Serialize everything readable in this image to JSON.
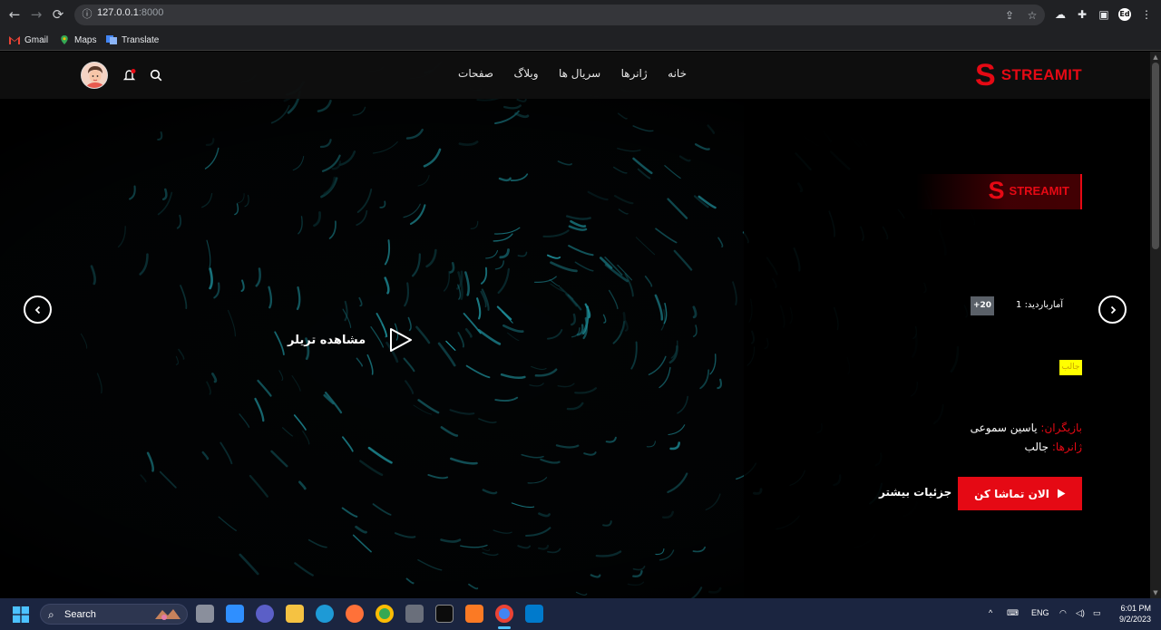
{
  "browser": {
    "url_host": "127.0.0.1",
    "url_port": ":8000",
    "bookmarks": [
      {
        "label": "Gmail",
        "icon": "gmail-icon"
      },
      {
        "label": "Maps",
        "icon": "maps-icon"
      },
      {
        "label": "Translate",
        "icon": "translate-icon"
      }
    ]
  },
  "site": {
    "logo_letter": "S",
    "logo_text": "STREAMIT",
    "menu": [
      "خانه",
      "ژانرها",
      "سریال ها",
      "وبلاگ",
      "صفحات"
    ],
    "hero": {
      "badge_letter": "S",
      "badge_text": "STREAMIT",
      "age_rating": "+20",
      "views_label": "آمارباردید:",
      "views_value": "1",
      "tag": "جالب",
      "cast_label": "بازیگران:",
      "cast_value": "یاسین سموعی",
      "genres_label": "ژانرها:",
      "genres_value": "جالب",
      "watch_button": "الان تماشا کن",
      "details_link": "جزئیات بیشتر",
      "trailer_label": "مشاهده تریلر"
    }
  },
  "taskbar": {
    "search_label": "Search",
    "language": "ENG",
    "time": "6:01 PM",
    "date": "9/2/2023"
  },
  "colors": {
    "accent": "#e50914",
    "tag_bg": "#ffff00",
    "taskbar": "#1b2540"
  }
}
